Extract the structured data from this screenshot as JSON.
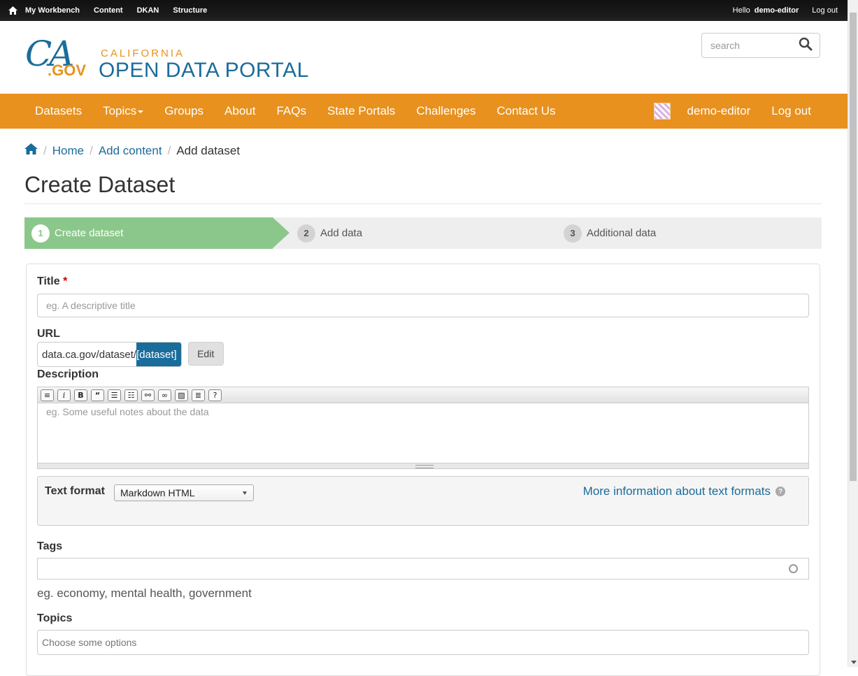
{
  "admin_bar": {
    "items": [
      "My Workbench",
      "Content",
      "DKAN",
      "Structure"
    ],
    "hello": "Hello",
    "username": "demo-editor",
    "logout": "Log out"
  },
  "header": {
    "logo_ca": "CA",
    "logo_gov": ".GOV",
    "logo_california": "CALIFORNIA",
    "logo_portal": "OPEN DATA PORTAL",
    "search_placeholder": "search"
  },
  "nav": {
    "items": [
      "Datasets",
      "Topics",
      "Groups",
      "About",
      "FAQs",
      "State Portals",
      "Challenges",
      "Contact Us"
    ],
    "user": "demo-editor",
    "logout": "Log out"
  },
  "breadcrumb": {
    "home": "Home",
    "add_content": "Add content",
    "current": "Add dataset"
  },
  "page_title": "Create Dataset",
  "steps": [
    {
      "num": "1",
      "label": "Create dataset",
      "active": true
    },
    {
      "num": "2",
      "label": "Add data",
      "active": false
    },
    {
      "num": "3",
      "label": "Additional data",
      "active": false
    }
  ],
  "form": {
    "title_label": "Title",
    "required_mark": "*",
    "title_placeholder": "eg. A descriptive title",
    "url_label": "URL",
    "url_prefix": "data.ca.gov/dataset/",
    "url_slug": "[dataset]",
    "edit_label": "Edit",
    "description_label": "Description",
    "description_placeholder": "eg. Some useful notes about the data",
    "toolbar_icons": [
      "paragraph-icon",
      "italic-icon",
      "bold-icon",
      "blockquote-icon",
      "ordered-list-icon",
      "unordered-list-icon",
      "link-icon",
      "unlink-icon",
      "image-icon",
      "align-icon",
      "help-icon"
    ],
    "text_format_label": "Text format",
    "text_format_value": "Markdown HTML",
    "text_format_help": "More information about text formats",
    "tags_label": "Tags",
    "tags_help": "eg. economy, mental health, government",
    "topics_label": "Topics",
    "topics_placeholder": "Choose some options"
  },
  "colors": {
    "brand_blue": "#1a6c9b",
    "brand_orange": "#e8911e",
    "step_active": "#8bc78a"
  }
}
